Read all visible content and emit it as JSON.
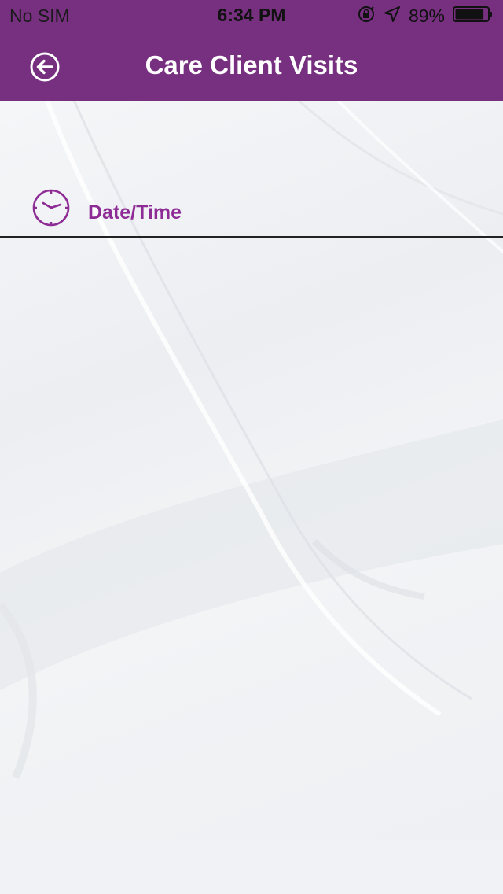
{
  "status_bar": {
    "carrier": "No SIM",
    "time": "6:34 PM",
    "battery": "89%",
    "battery_level": 0.89,
    "icons": [
      "orientation-lock-icon",
      "location-arrow-icon",
      "battery-icon"
    ]
  },
  "header": {
    "title": "Care Client Visits",
    "back_icon": "back-arrow-circle-icon",
    "background_color": "#76307f"
  },
  "datetime": {
    "label": "Date/Time",
    "icon": "clock-icon",
    "accent_color": "#8e2c96"
  }
}
